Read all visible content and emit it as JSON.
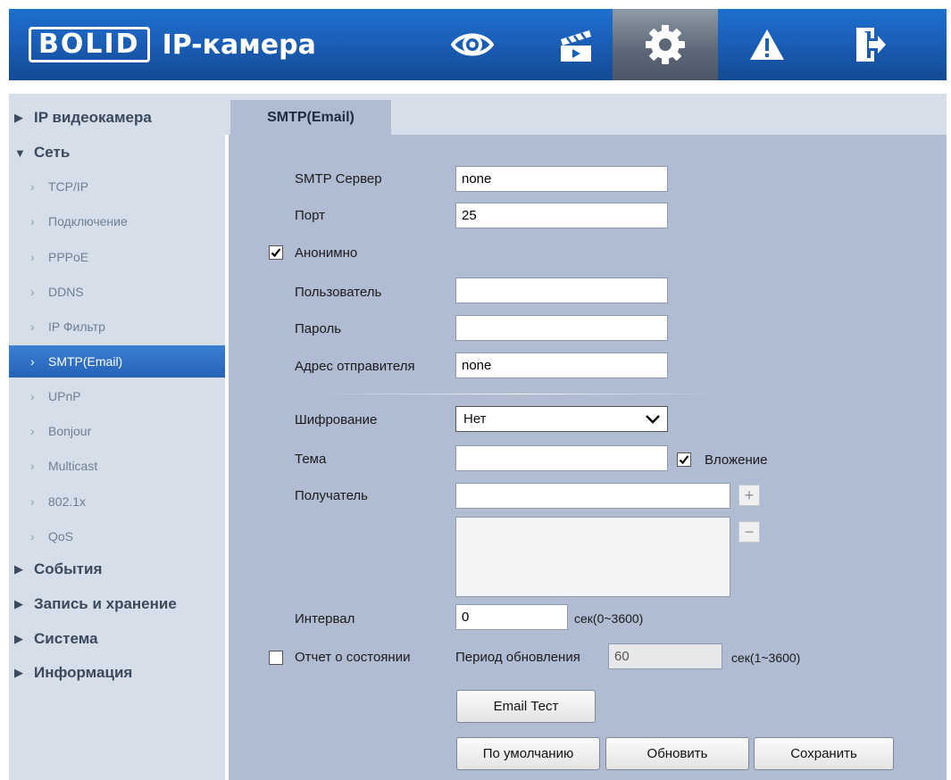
{
  "header": {
    "brand": "BOLID",
    "title": "IP-камера",
    "nav": [
      {
        "name": "live-view",
        "icon": "eye-icon",
        "active": false
      },
      {
        "name": "playback",
        "icon": "clapperboard-icon",
        "active": false
      },
      {
        "name": "settings",
        "icon": "gear-icon",
        "active": true
      },
      {
        "name": "alarm",
        "icon": "warning-icon",
        "active": false
      },
      {
        "name": "logout",
        "icon": "logout-icon",
        "active": false
      }
    ]
  },
  "sidebar": {
    "groups": {
      "camera": "IP видеокамера",
      "network": "Сеть",
      "events": "События",
      "storage": "Запись и хранение",
      "system": "Система",
      "info": "Информация"
    },
    "network_items": [
      "TCP/IP",
      "Подключение",
      "PPPoE",
      "DDNS",
      "IP Фильтр",
      "SMTP(Email)",
      "UPnP",
      "Bonjour",
      "Multicast",
      "802.1x",
      "QoS"
    ],
    "active_item": "SMTP(Email)"
  },
  "tab": {
    "label": "SMTP(Email)"
  },
  "form": {
    "smtp_server": {
      "label": "SMTP Сервер",
      "value": "none"
    },
    "port": {
      "label": "Порт",
      "value": "25"
    },
    "anonymous": {
      "label": "Анонимно",
      "checked": true
    },
    "user": {
      "label": "Пользователь",
      "value": ""
    },
    "password": {
      "label": "Пароль",
      "value": ""
    },
    "sender": {
      "label": "Адрес отправителя",
      "value": "none"
    },
    "encryption": {
      "label": "Шифрование",
      "value": "Нет"
    },
    "subject": {
      "label": "Тема",
      "value": ""
    },
    "attachment": {
      "label": "Вложение",
      "checked": true
    },
    "recipient": {
      "label": "Получатель",
      "value": "",
      "add": "+",
      "remove": "−"
    },
    "interval": {
      "label": "Интервал",
      "value": "0",
      "unit": "сек(0~3600)"
    },
    "health_report": {
      "label": "Отчет о состоянии",
      "checked": false
    },
    "update_period": {
      "label": "Период обновления",
      "value": "60",
      "unit": "сек(1~3600)"
    }
  },
  "buttons": {
    "email_test": "Email Тест",
    "default": "По умолчанию",
    "refresh": "Обновить",
    "save": "Сохранить"
  },
  "colors": {
    "header_blue": "#1a5fb8",
    "sidebar_bg": "#d6dfe9",
    "content_bg": "#afbcd2",
    "active_item": "#2f6fc6"
  }
}
